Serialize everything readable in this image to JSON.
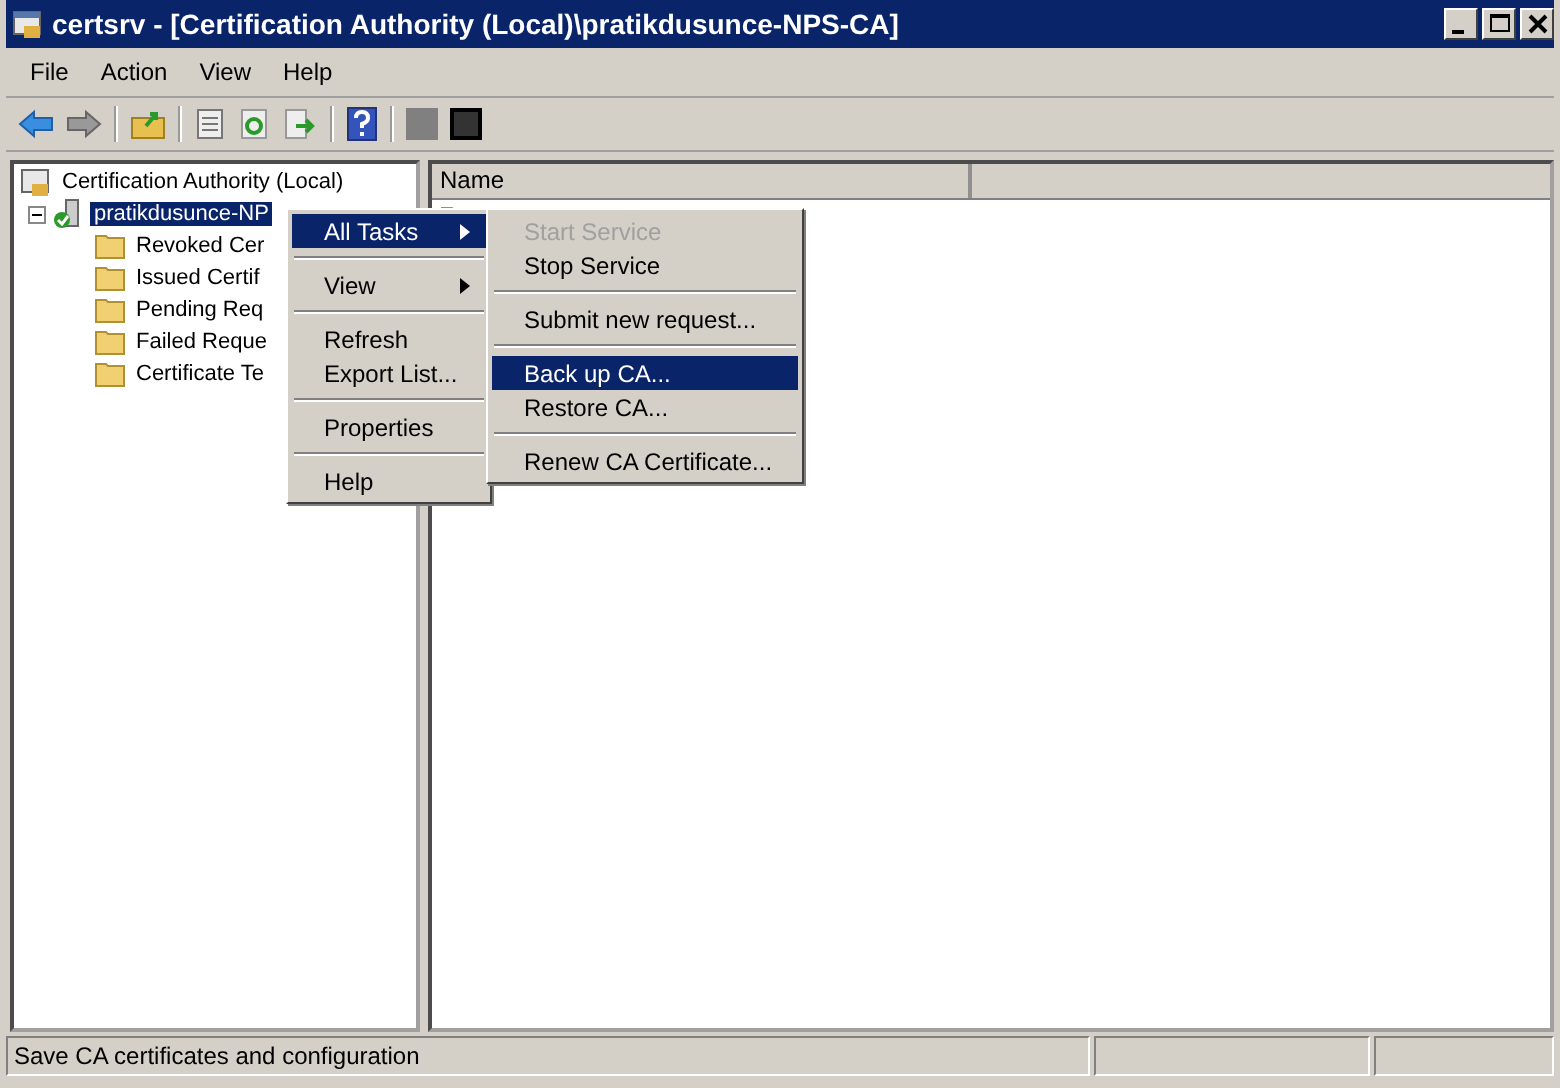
{
  "window": {
    "title": "certsrv - [Certification Authority (Local)\\pratikdusunce-NPS-CA]"
  },
  "menu_bar": [
    "File",
    "Action",
    "View",
    "Help"
  ],
  "tree": {
    "label": "Certification Authority (Local)",
    "children": [
      {
        "label": "pratikdusunce-NP",
        "selected": true,
        "expanded": true,
        "children": [
          {
            "label": "Revoked Cer",
            "selected": false
          },
          {
            "label": "Issued Certif",
            "selected": false
          },
          {
            "label": "Pending Req",
            "selected": false
          },
          {
            "label": "Failed Reque",
            "selected": false
          },
          {
            "label": "Certificate Te",
            "selected": false
          }
        ]
      }
    ]
  },
  "list": {
    "columns": [
      "Name"
    ]
  },
  "context_menu": [
    {
      "kind": "item",
      "label": "All Tasks",
      "selected": true,
      "submenu": true
    },
    {
      "kind": "separator"
    },
    {
      "kind": "item",
      "label": "View",
      "selected": false,
      "submenu": true
    },
    {
      "kind": "separator"
    },
    {
      "kind": "item",
      "label": "Refresh",
      "selected": false,
      "submenu": false
    },
    {
      "kind": "item",
      "label": "Export List...",
      "selected": false,
      "submenu": false
    },
    {
      "kind": "separator"
    },
    {
      "kind": "item",
      "label": "Properties",
      "selected": false,
      "submenu": false
    },
    {
      "kind": "separator"
    },
    {
      "kind": "item",
      "label": "Help",
      "selected": false,
      "submenu": false
    }
  ],
  "submenu": [
    {
      "kind": "item",
      "label": "Start Service",
      "selected": false,
      "disabled": true
    },
    {
      "kind": "item",
      "label": "Stop Service",
      "selected": false,
      "disabled": false
    },
    {
      "kind": "separator"
    },
    {
      "kind": "item",
      "label": "Submit new request...",
      "selected": false,
      "disabled": false
    },
    {
      "kind": "separator"
    },
    {
      "kind": "item",
      "label": "Back up CA...",
      "selected": true,
      "disabled": false
    },
    {
      "kind": "item",
      "label": "Restore CA...",
      "selected": false,
      "disabled": false
    },
    {
      "kind": "separator"
    },
    {
      "kind": "item",
      "label": "Renew CA Certificate...",
      "selected": false,
      "disabled": false
    }
  ],
  "status_bar": [
    "Save CA certificates and configuration"
  ]
}
